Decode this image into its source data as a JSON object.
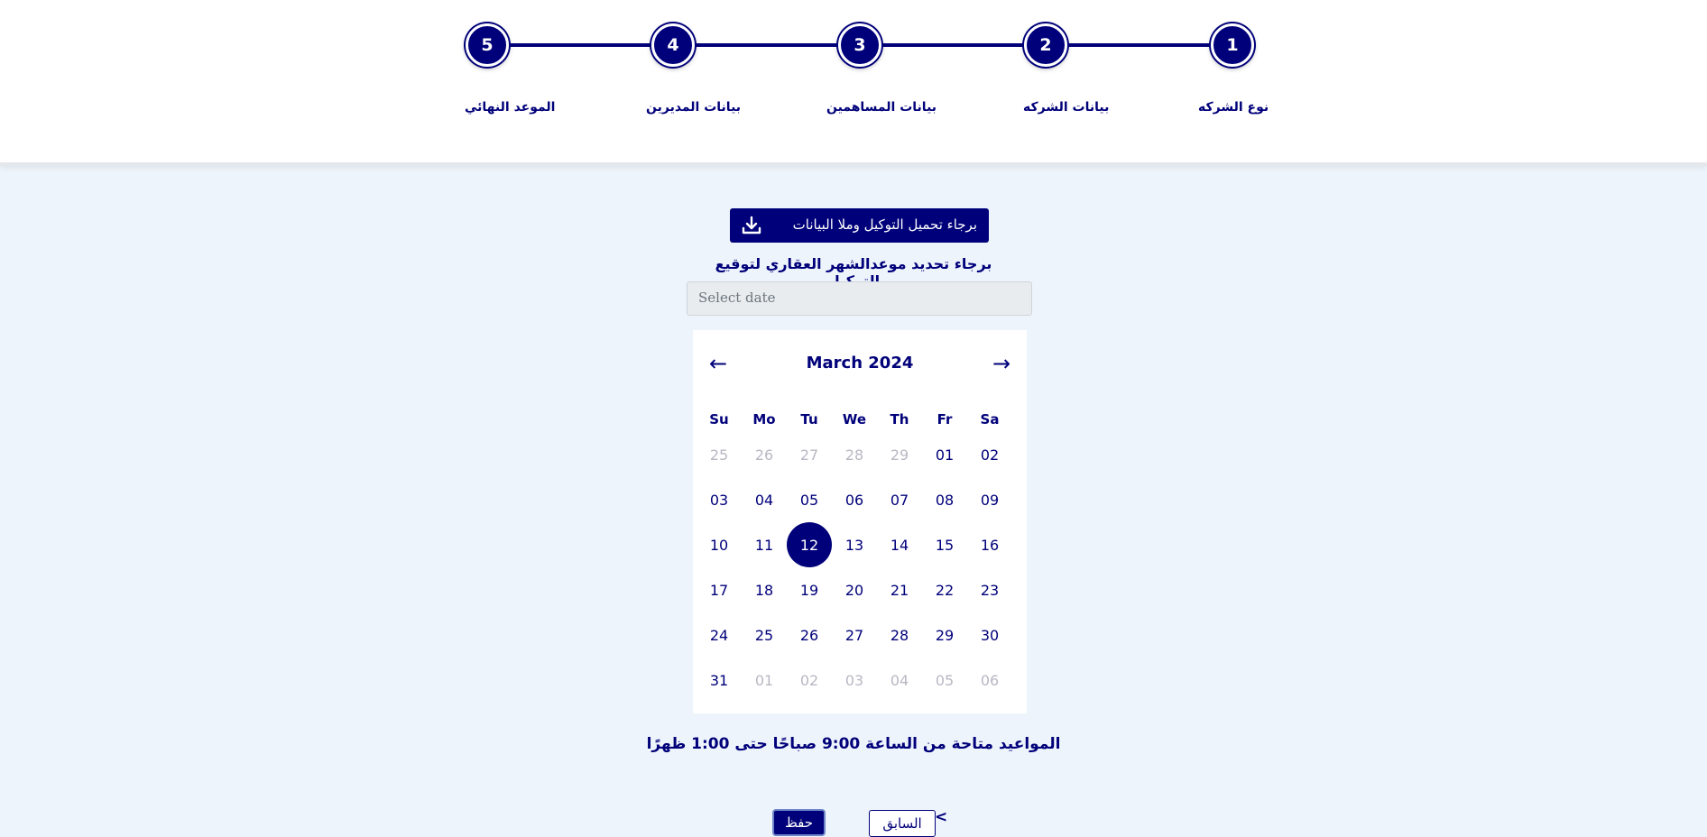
{
  "stepper": {
    "steps": [
      {
        "number": "1",
        "label": "نوع الشركه"
      },
      {
        "number": "2",
        "label": "بيانات الشركه"
      },
      {
        "number": "3",
        "label": "بيانات المساهمين"
      },
      {
        "number": "4",
        "label": "بيانات المديرين"
      },
      {
        "number": "5",
        "label": "الموعد النهائي"
      }
    ]
  },
  "download": {
    "label": "برجاء تحميل التوكيل وملا البيانات",
    "icon": "download-icon"
  },
  "prompt": "برجاء تحديد موعدالشهر العقاري لتوقيع التوكيل",
  "date_input": {
    "placeholder": "Select date",
    "value": ""
  },
  "calendar": {
    "title": "March 2024",
    "prev_label": "←",
    "next_label": "→",
    "weekdays": [
      "Su",
      "Mo",
      "Tu",
      "We",
      "Th",
      "Fr",
      "Sa"
    ],
    "weeks": [
      [
        {
          "d": "25",
          "m": true
        },
        {
          "d": "26",
          "m": true
        },
        {
          "d": "27",
          "m": true
        },
        {
          "d": "28",
          "m": true
        },
        {
          "d": "29",
          "m": true
        },
        {
          "d": "01"
        },
        {
          "d": "02"
        }
      ],
      [
        {
          "d": "03"
        },
        {
          "d": "04"
        },
        {
          "d": "05"
        },
        {
          "d": "06"
        },
        {
          "d": "07"
        },
        {
          "d": "08"
        },
        {
          "d": "09"
        }
      ],
      [
        {
          "d": "10"
        },
        {
          "d": "11"
        },
        {
          "d": "12",
          "sel": true
        },
        {
          "d": "13"
        },
        {
          "d": "14"
        },
        {
          "d": "15"
        },
        {
          "d": "16"
        }
      ],
      [
        {
          "d": "17"
        },
        {
          "d": "18"
        },
        {
          "d": "19"
        },
        {
          "d": "20"
        },
        {
          "d": "21"
        },
        {
          "d": "22"
        },
        {
          "d": "23"
        }
      ],
      [
        {
          "d": "24"
        },
        {
          "d": "25"
        },
        {
          "d": "26"
        },
        {
          "d": "27"
        },
        {
          "d": "28"
        },
        {
          "d": "29"
        },
        {
          "d": "30"
        }
      ],
      [
        {
          "d": "31"
        },
        {
          "d": "01",
          "m": true
        },
        {
          "d": "02",
          "m": true
        },
        {
          "d": "03",
          "m": true
        },
        {
          "d": "04",
          "m": true
        },
        {
          "d": "05",
          "m": true
        },
        {
          "d": "06",
          "m": true
        }
      ]
    ]
  },
  "hours_note": "المواعيد متاحة من الساعة 9:00 صباحًا حتى 1:00 ظهرًا",
  "buttons": {
    "save": "حفظ",
    "previous": "السابق",
    "chevron": "<"
  },
  "colors": {
    "primary": "#00007a",
    "background": "#eef4fb",
    "muted": "#b8b8c4"
  }
}
